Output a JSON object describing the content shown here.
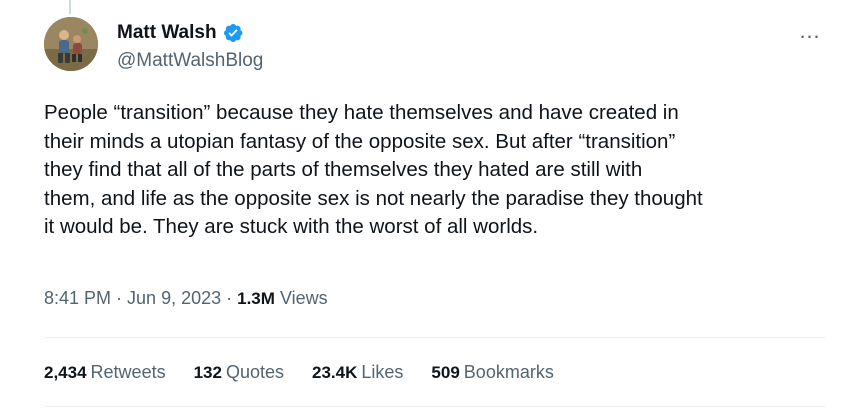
{
  "author": {
    "display_name": "Matt Walsh",
    "handle": "@MattWalshBlog",
    "verified_color": "#1d9bf0",
    "avatar_icon": "profile-photo"
  },
  "more_icon": "…",
  "tweet": {
    "text": "People “transition” because they hate themselves and have created in\ntheir minds a utopian fantasy of the opposite sex. But after “transition”\nthey find that all of the parts of themselves they hated are still with\nthem, and life as the opposite sex is not nearly the paradise they thought\nit would be. They are stuck with the worst of all worlds."
  },
  "meta": {
    "time": "8:41 PM",
    "sep1": "·",
    "date": "Jun 9, 2023",
    "sep2": "·",
    "views_count": "1.3M",
    "views_label": "Views"
  },
  "stats": {
    "retweets_count": "2,434",
    "retweets_label": "Retweets",
    "quotes_count": "132",
    "quotes_label": "Quotes",
    "likes_count": "23.4K",
    "likes_label": "Likes",
    "bookmarks_count": "509",
    "bookmarks_label": "Bookmarks"
  },
  "colors": {
    "text": "#0f1419",
    "secondary": "#536471",
    "divider": "#eff3f4"
  }
}
